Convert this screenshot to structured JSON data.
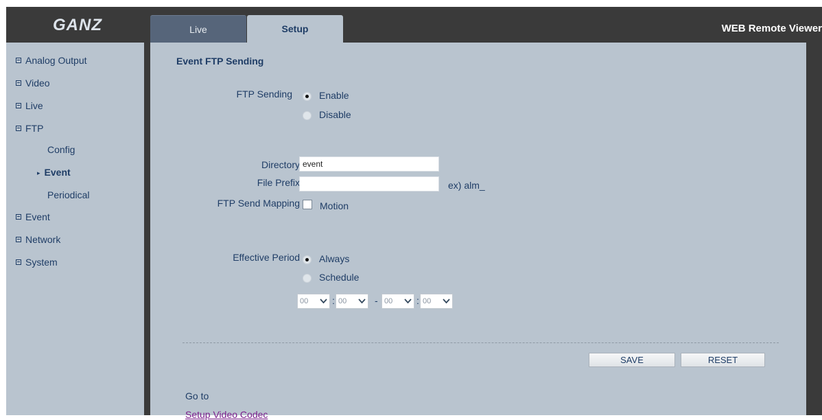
{
  "header": {
    "logo_text": "GANZ",
    "app_title": "WEB Remote Viewer",
    "tabs": [
      {
        "label": "Live",
        "active": false
      },
      {
        "label": "Setup",
        "active": true
      }
    ]
  },
  "sidebar": {
    "items": [
      {
        "label": "Analog Output"
      },
      {
        "label": "Video"
      },
      {
        "label": "Live"
      },
      {
        "label": "FTP"
      },
      {
        "label": "Event"
      },
      {
        "label": "Network"
      },
      {
        "label": "System"
      }
    ],
    "ftp_subitems": [
      {
        "label": "Config",
        "active": false
      },
      {
        "label": "Event",
        "active": true
      },
      {
        "label": "Periodical",
        "active": false
      }
    ]
  },
  "main": {
    "section_title": "Event FTP Sending",
    "ftp_sending": {
      "label": "FTP Sending",
      "options": [
        "Enable",
        "Disable"
      ],
      "selected": "Enable"
    },
    "directory": {
      "label": "Directory",
      "value": "event"
    },
    "file_prefix": {
      "label": "File Prefix",
      "value": "",
      "hint": "ex) alm_"
    },
    "send_mapping": {
      "label": "FTP Send Mapping",
      "option": "Motion",
      "checked": false
    },
    "effective_period": {
      "label": "Effective Period",
      "options": [
        "Always",
        "Schedule"
      ],
      "selected": "Always"
    },
    "schedule": {
      "start_hour": "00",
      "start_min": "00",
      "end_hour": "00",
      "end_min": "00",
      "colon": ":",
      "dash": "-"
    },
    "buttons": {
      "save": "SAVE",
      "reset": "RESET"
    },
    "goto": {
      "label": "Go to",
      "link": "Setup Video Codec"
    }
  },
  "colors": {
    "frame": "#3a3a3a",
    "panel": "#b9c4cf",
    "tab_inactive": "#56657a",
    "text": "#1f3d66",
    "link": "#7a1f8c"
  }
}
